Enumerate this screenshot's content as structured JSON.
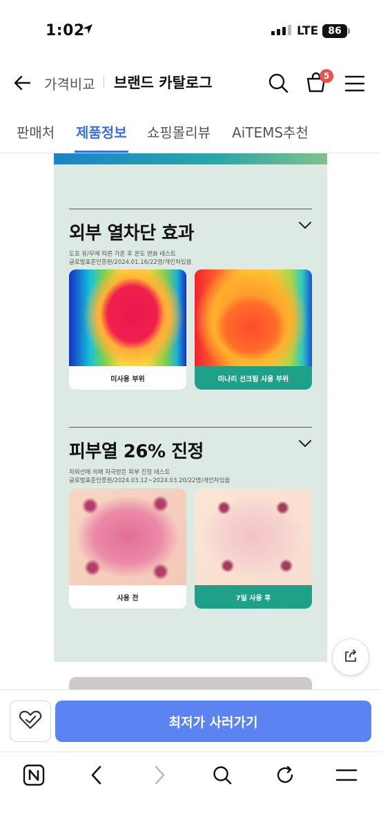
{
  "status_bar": {
    "time": "1:02",
    "network": "LTE",
    "battery": "86"
  },
  "header": {
    "breadcrumb": "가격비교",
    "title": "브랜드 카탈로그",
    "cart_count": "5"
  },
  "tabs": [
    {
      "label": "판매처",
      "active": false
    },
    {
      "label": "제품정보",
      "active": true
    },
    {
      "label": "쇼핑몰리뷰",
      "active": false
    },
    {
      "label": "AiTEMS추천",
      "active": false
    }
  ],
  "content": {
    "section1": {
      "title": "외부 열차단 효과",
      "note_line1": "도포 유/무에 따른 가온 후 온도 변화 테스트",
      "note_line2": "글로벌표준인증원/2024.01.16/22명/개인차있음",
      "image_left_caption": "미사용 부위",
      "image_right_caption": "미나리 선크림 사용 부위"
    },
    "section2": {
      "title": "피부열 26% 진정",
      "note_line1": "자외선에 의해 자극받은 피부 진정 테스트",
      "note_line2": "글로벌표준인증원/2024.03.12~2024.03.20/22명/개인차있음",
      "image_left_caption": "사용 전",
      "image_right_caption": "7일 사용 후"
    }
  },
  "purchase": {
    "buy_label": "최저가 사러가기"
  },
  "colors": {
    "accent": "#3f6fe6",
    "buy_button": "#5b84f2",
    "teal_caption": "#1fa088",
    "panel_bg": "#dde9e3",
    "badge": "#f04d4d"
  },
  "icons": [
    "back-arrow-icon",
    "search-icon",
    "cart-icon",
    "menu-icon",
    "chevron-down-icon",
    "share-icon",
    "heart-check-icon",
    "naver-icon",
    "browser-back-icon",
    "browser-forward-icon",
    "refresh-icon",
    "browser-menu-icon"
  ]
}
